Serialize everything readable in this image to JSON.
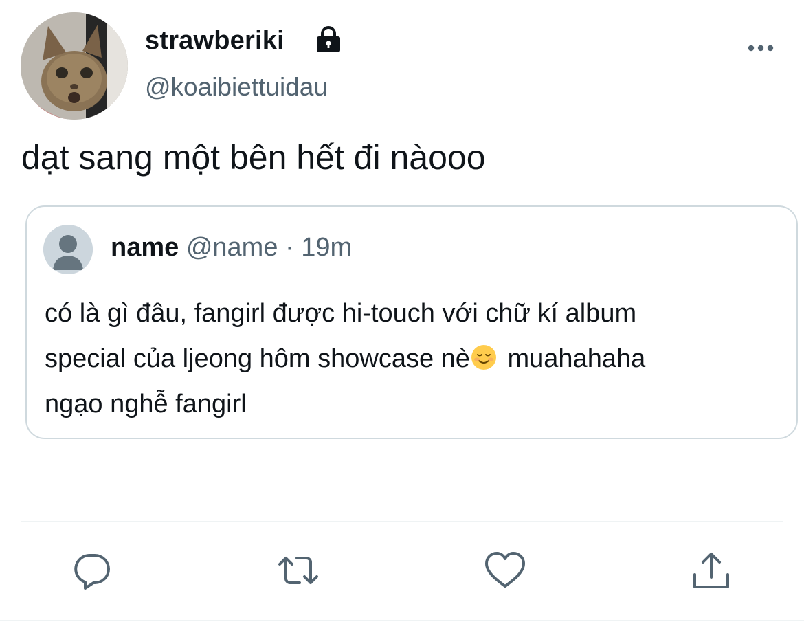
{
  "author": {
    "display_name": "strawberiki",
    "handle": "@koaibiettuidau",
    "avatar_icon": "cat-avatar",
    "protected_icon": "lock-icon"
  },
  "tweet": {
    "text": "dạt sang một bên hết đi nàooo"
  },
  "quoted_tweet": {
    "name": "name",
    "handle": "@name",
    "separator": "·",
    "time": "19m",
    "lines": [
      "có là gì đâu, fangirl được hi-touch với chữ kí album",
      "special của ljeong hôm showcase nè",
      "muahahaha",
      "ngạo nghễ fangirl"
    ],
    "emoji": "smiling-face-icon"
  },
  "actions": [
    "reply-icon",
    "retweet-icon",
    "like-icon",
    "share-icon"
  ],
  "colors": {
    "text_primary": "#0f1419",
    "text_secondary": "#536471",
    "border": "#cfd9de",
    "divider": "#eff3f4"
  }
}
